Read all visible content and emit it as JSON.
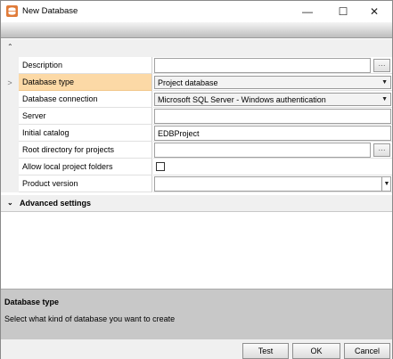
{
  "window": {
    "title": "New Database"
  },
  "titlebar": {
    "minimize": "—",
    "maximize": "☐",
    "close": "✕"
  },
  "grid": {
    "rows": [
      {
        "label": "Description",
        "value": "",
        "kind": "text-ellipsis"
      },
      {
        "label": "Database type",
        "value": "Project database",
        "kind": "combo",
        "selected": true
      },
      {
        "label": "Database connection",
        "value": "Microsoft SQL Server - Windows authentication",
        "kind": "combo"
      },
      {
        "label": "Server",
        "value": "",
        "kind": "text"
      },
      {
        "label": "Initial catalog",
        "value": "EDBProject",
        "kind": "text"
      },
      {
        "label": "Root directory for projects",
        "value": "",
        "kind": "text-ellipsis"
      },
      {
        "label": "Allow local project folders",
        "value": "",
        "kind": "checkbox"
      },
      {
        "label": "Product version",
        "value": "",
        "kind": "dropdown"
      }
    ]
  },
  "advanced": {
    "label": "Advanced settings"
  },
  "description_panel": {
    "title": "Database type",
    "text": "Select what kind of database you want to create"
  },
  "footer": {
    "test": "Test",
    "ok": "OK",
    "cancel": "Cancel"
  },
  "colors": {
    "selected_row": "#fcd9a6",
    "desc_bg": "#c8c8c8",
    "app_icon": "#e07b39"
  }
}
